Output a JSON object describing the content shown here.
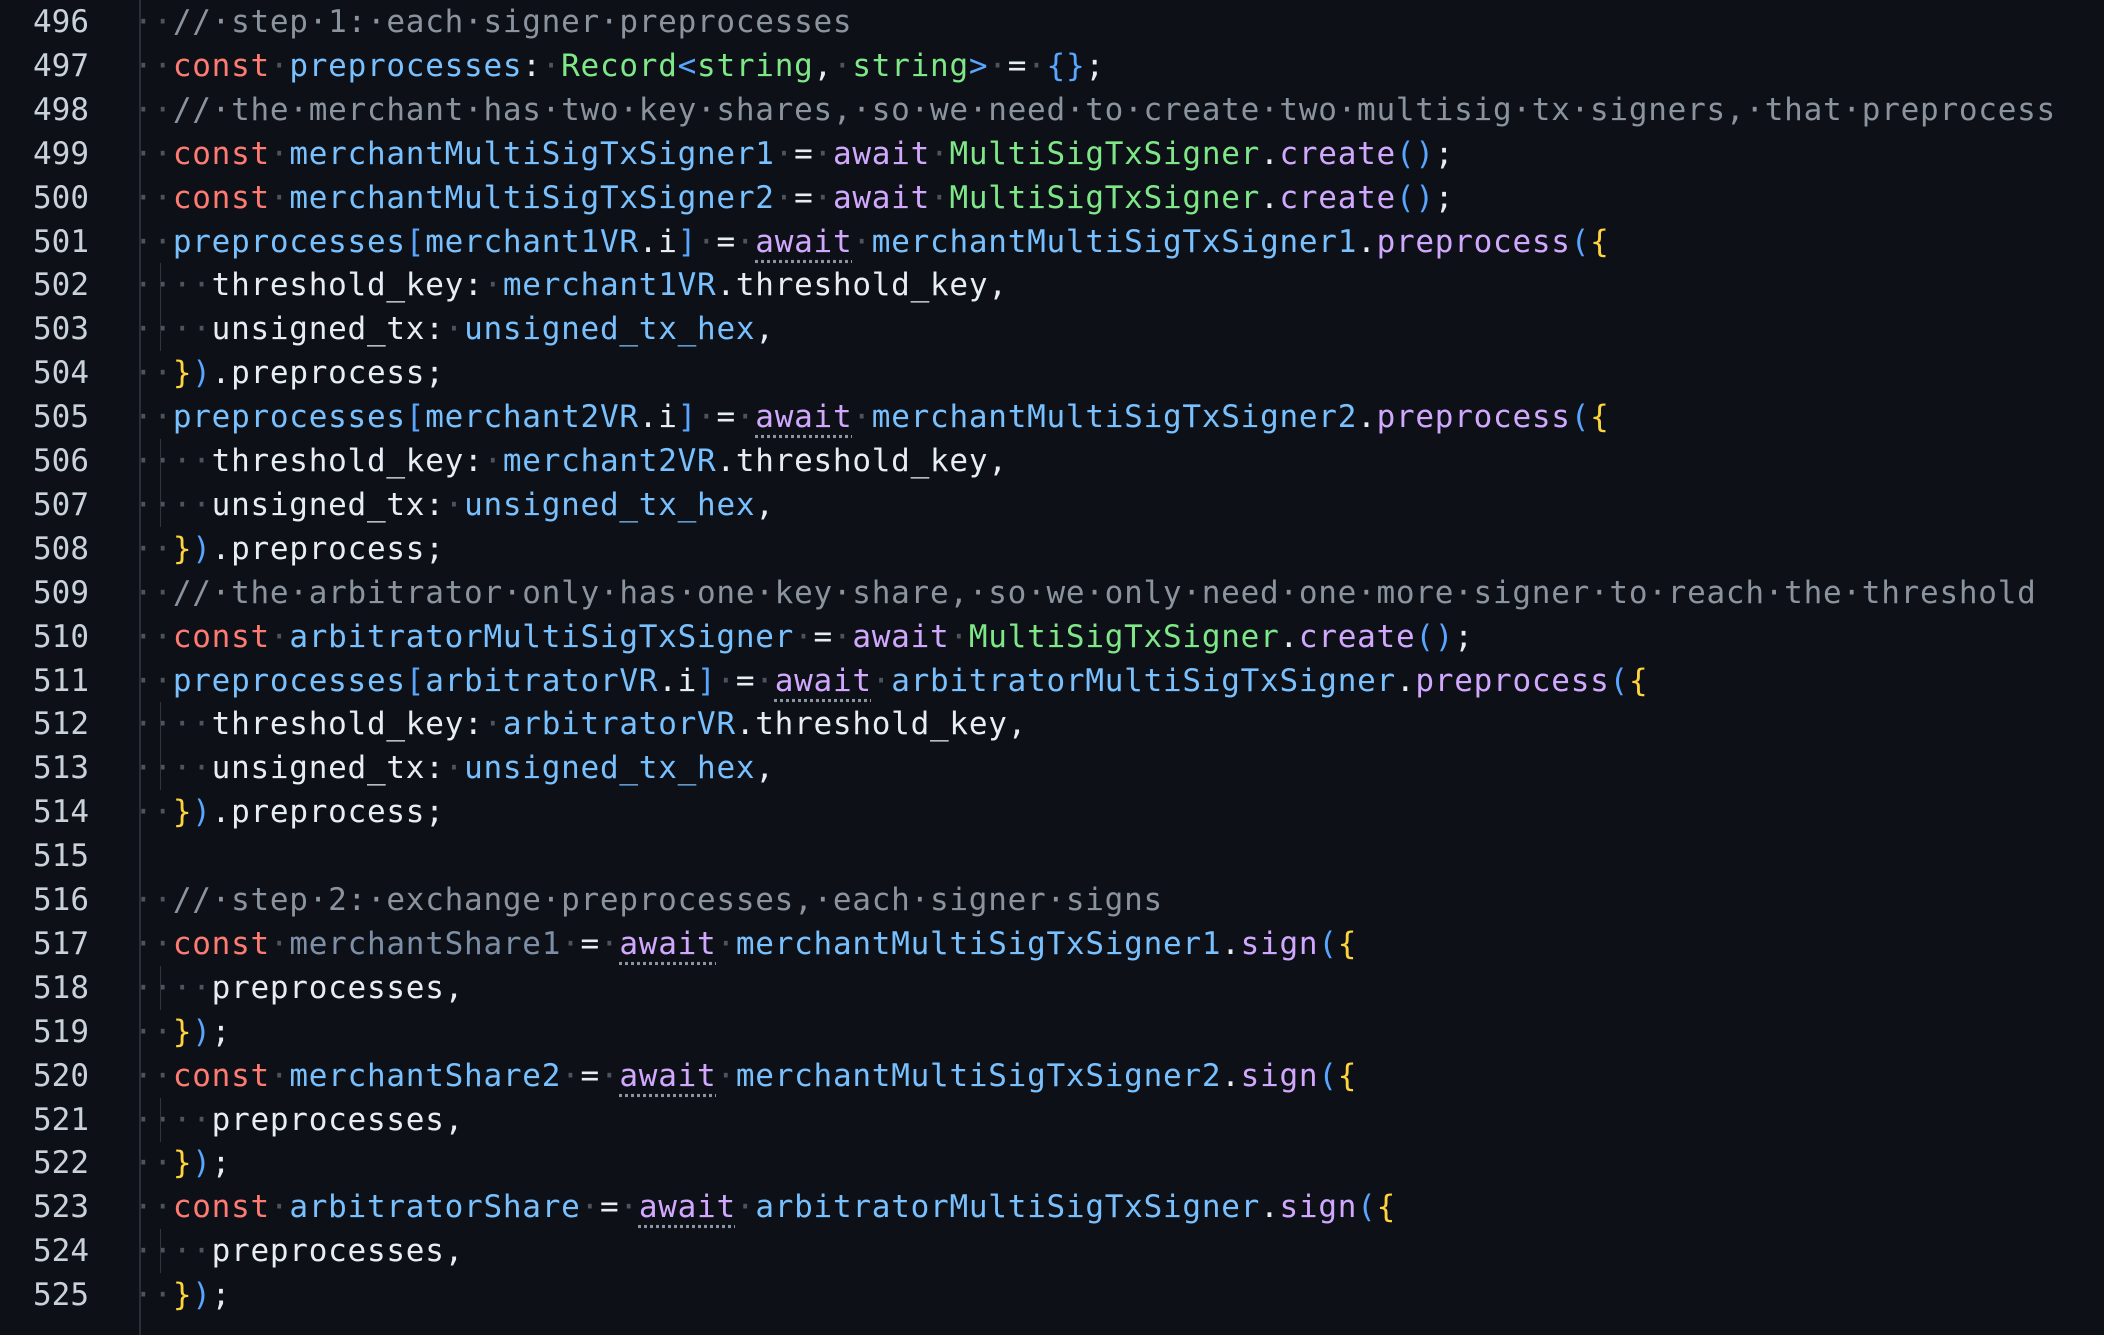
{
  "editor": {
    "colors": {
      "background": "#0d1117",
      "line_number": "#c9d1d9",
      "whitespace_dot": "#4d545d",
      "comment": "#8b949e",
      "keyword": "#ff7b72",
      "await": "#d2a8ff",
      "variable": "#79c0ff",
      "type": "#7ee787",
      "function": "#d2a8ff",
      "brace": "#ffd33d",
      "paren": "#58a6ff"
    },
    "lines": [
      {
        "n": "496",
        "indent": 1,
        "tokens": [
          [
            "comment",
            "//·step·1:·each·signer·preprocesses"
          ]
        ]
      },
      {
        "n": "497",
        "indent": 1,
        "tokens": [
          [
            "keyword",
            "const"
          ],
          [
            "ws",
            "·"
          ],
          [
            "var",
            "preprocesses"
          ],
          [
            "text",
            ":"
          ],
          [
            "ws",
            "·"
          ],
          [
            "type",
            "Record"
          ],
          [
            "paren",
            "<"
          ],
          [
            "type",
            "string"
          ],
          [
            "text",
            ","
          ],
          [
            "ws",
            "·"
          ],
          [
            "type",
            "string"
          ],
          [
            "paren",
            ">"
          ],
          [
            "ws",
            "·"
          ],
          [
            "text",
            "="
          ],
          [
            "ws",
            "·"
          ],
          [
            "paren",
            "{}"
          ],
          [
            "text",
            ";"
          ]
        ]
      },
      {
        "n": "498",
        "indent": 1,
        "tokens": [
          [
            "comment",
            "//·the·merchant·has·two·key·shares,·so·we·need·to·create·two·multisig·tx·signers,·that·preprocess"
          ]
        ]
      },
      {
        "n": "499",
        "indent": 1,
        "tokens": [
          [
            "keyword",
            "const"
          ],
          [
            "ws",
            "·"
          ],
          [
            "var",
            "merchantMultiSigTxSigner1"
          ],
          [
            "ws",
            "·"
          ],
          [
            "text",
            "="
          ],
          [
            "ws",
            "·"
          ],
          [
            "await",
            "await"
          ],
          [
            "ws",
            "·"
          ],
          [
            "type",
            "MultiSigTxSigner"
          ],
          [
            "text",
            "."
          ],
          [
            "func",
            "create"
          ],
          [
            "paren",
            "()"
          ],
          [
            "text",
            ";"
          ]
        ]
      },
      {
        "n": "500",
        "indent": 1,
        "tokens": [
          [
            "keyword",
            "const"
          ],
          [
            "ws",
            "·"
          ],
          [
            "var",
            "merchantMultiSigTxSigner2"
          ],
          [
            "ws",
            "·"
          ],
          [
            "text",
            "="
          ],
          [
            "ws",
            "·"
          ],
          [
            "await",
            "await"
          ],
          [
            "ws",
            "·"
          ],
          [
            "type",
            "MultiSigTxSigner"
          ],
          [
            "text",
            "."
          ],
          [
            "func",
            "create"
          ],
          [
            "paren",
            "()"
          ],
          [
            "text",
            ";"
          ]
        ]
      },
      {
        "n": "501",
        "indent": 1,
        "tokens": [
          [
            "var",
            "preprocesses"
          ],
          [
            "bracket",
            "["
          ],
          [
            "var",
            "merchant1VR"
          ],
          [
            "text",
            ".i"
          ],
          [
            "bracket",
            "]"
          ],
          [
            "ws",
            "·"
          ],
          [
            "text",
            "="
          ],
          [
            "ws",
            "·"
          ],
          [
            "awaitdot",
            "await"
          ],
          [
            "ws",
            "·"
          ],
          [
            "var",
            "merchantMultiSigTxSigner1"
          ],
          [
            "text",
            "."
          ],
          [
            "func",
            "preprocess"
          ],
          [
            "paren",
            "("
          ],
          [
            "brace",
            "{"
          ]
        ]
      },
      {
        "n": "502",
        "indent": 2,
        "tokens": [
          [
            "prop",
            "threshold_key"
          ],
          [
            "text",
            ":"
          ],
          [
            "ws",
            "·"
          ],
          [
            "var",
            "merchant1VR"
          ],
          [
            "text",
            ".threshold_key,"
          ]
        ]
      },
      {
        "n": "503",
        "indent": 2,
        "tokens": [
          [
            "prop",
            "unsigned_tx"
          ],
          [
            "text",
            ":"
          ],
          [
            "ws",
            "·"
          ],
          [
            "var",
            "unsigned_tx_hex"
          ],
          [
            "text",
            ","
          ]
        ]
      },
      {
        "n": "504",
        "indent": 1,
        "tokens": [
          [
            "brace",
            "}"
          ],
          [
            "paren",
            ")"
          ],
          [
            "text",
            ".preprocess;"
          ]
        ]
      },
      {
        "n": "505",
        "indent": 1,
        "tokens": [
          [
            "var",
            "preprocesses"
          ],
          [
            "bracket",
            "["
          ],
          [
            "var",
            "merchant2VR"
          ],
          [
            "text",
            ".i"
          ],
          [
            "bracket",
            "]"
          ],
          [
            "ws",
            "·"
          ],
          [
            "text",
            "="
          ],
          [
            "ws",
            "·"
          ],
          [
            "awaitdot",
            "await"
          ],
          [
            "ws",
            "·"
          ],
          [
            "var",
            "merchantMultiSigTxSigner2"
          ],
          [
            "text",
            "."
          ],
          [
            "func",
            "preprocess"
          ],
          [
            "paren",
            "("
          ],
          [
            "brace",
            "{"
          ]
        ]
      },
      {
        "n": "506",
        "indent": 2,
        "tokens": [
          [
            "prop",
            "threshold_key"
          ],
          [
            "text",
            ":"
          ],
          [
            "ws",
            "·"
          ],
          [
            "var",
            "merchant2VR"
          ],
          [
            "text",
            ".threshold_key,"
          ]
        ]
      },
      {
        "n": "507",
        "indent": 2,
        "tokens": [
          [
            "prop",
            "unsigned_tx"
          ],
          [
            "text",
            ":"
          ],
          [
            "ws",
            "·"
          ],
          [
            "var",
            "unsigned_tx_hex"
          ],
          [
            "text",
            ","
          ]
        ]
      },
      {
        "n": "508",
        "indent": 1,
        "tokens": [
          [
            "brace",
            "}"
          ],
          [
            "paren",
            ")"
          ],
          [
            "text",
            ".preprocess;"
          ]
        ]
      },
      {
        "n": "509",
        "indent": 1,
        "tokens": [
          [
            "comment",
            "//·the·arbitrator·only·has·one·key·share,·so·we·only·need·one·more·signer·to·reach·the·threshold"
          ]
        ]
      },
      {
        "n": "510",
        "indent": 1,
        "tokens": [
          [
            "keyword",
            "const"
          ],
          [
            "ws",
            "·"
          ],
          [
            "var",
            "arbitratorMultiSigTxSigner"
          ],
          [
            "ws",
            "·"
          ],
          [
            "text",
            "="
          ],
          [
            "ws",
            "·"
          ],
          [
            "await",
            "await"
          ],
          [
            "ws",
            "·"
          ],
          [
            "type",
            "MultiSigTxSigner"
          ],
          [
            "text",
            "."
          ],
          [
            "func",
            "create"
          ],
          [
            "paren",
            "()"
          ],
          [
            "text",
            ";"
          ]
        ]
      },
      {
        "n": "511",
        "indent": 1,
        "tokens": [
          [
            "var",
            "preprocesses"
          ],
          [
            "bracket",
            "["
          ],
          [
            "var",
            "arbitratorVR"
          ],
          [
            "text",
            ".i"
          ],
          [
            "bracket",
            "]"
          ],
          [
            "ws",
            "·"
          ],
          [
            "text",
            "="
          ],
          [
            "ws",
            "·"
          ],
          [
            "awaitdot",
            "await"
          ],
          [
            "ws",
            "·"
          ],
          [
            "var",
            "arbitratorMultiSigTxSigner"
          ],
          [
            "text",
            "."
          ],
          [
            "func",
            "preprocess"
          ],
          [
            "paren",
            "("
          ],
          [
            "brace",
            "{"
          ]
        ]
      },
      {
        "n": "512",
        "indent": 2,
        "tokens": [
          [
            "prop",
            "threshold_key"
          ],
          [
            "text",
            ":"
          ],
          [
            "ws",
            "·"
          ],
          [
            "var",
            "arbitratorVR"
          ],
          [
            "text",
            ".threshold_key,"
          ]
        ]
      },
      {
        "n": "513",
        "indent": 2,
        "tokens": [
          [
            "prop",
            "unsigned_tx"
          ],
          [
            "text",
            ":"
          ],
          [
            "ws",
            "·"
          ],
          [
            "var",
            "unsigned_tx_hex"
          ],
          [
            "text",
            ","
          ]
        ]
      },
      {
        "n": "514",
        "indent": 1,
        "tokens": [
          [
            "brace",
            "}"
          ],
          [
            "paren",
            ")"
          ],
          [
            "text",
            ".preprocess;"
          ]
        ]
      },
      {
        "n": "515",
        "indent": 0,
        "tokens": []
      },
      {
        "n": "516",
        "indent": 1,
        "tokens": [
          [
            "comment",
            "//·step·2:·exchange·preprocesses,·each·signer·signs"
          ]
        ]
      },
      {
        "n": "517",
        "indent": 1,
        "tokens": [
          [
            "keyword",
            "const"
          ],
          [
            "ws",
            "·"
          ],
          [
            "dimvar",
            "merchantShare1"
          ],
          [
            "ws",
            "·"
          ],
          [
            "text",
            "="
          ],
          [
            "ws",
            "·"
          ],
          [
            "awaitdot",
            "await"
          ],
          [
            "ws",
            "·"
          ],
          [
            "var",
            "merchantMultiSigTxSigner1"
          ],
          [
            "text",
            "."
          ],
          [
            "func",
            "sign"
          ],
          [
            "paren",
            "("
          ],
          [
            "brace",
            "{"
          ]
        ]
      },
      {
        "n": "518",
        "indent": 2,
        "tokens": [
          [
            "prop",
            "preprocesses,"
          ]
        ]
      },
      {
        "n": "519",
        "indent": 1,
        "tokens": [
          [
            "brace",
            "}"
          ],
          [
            "paren",
            ")"
          ],
          [
            "text",
            ";"
          ]
        ]
      },
      {
        "n": "520",
        "indent": 1,
        "tokens": [
          [
            "keyword",
            "const"
          ],
          [
            "ws",
            "·"
          ],
          [
            "var",
            "merchantShare2"
          ],
          [
            "ws",
            "·"
          ],
          [
            "text",
            "="
          ],
          [
            "ws",
            "·"
          ],
          [
            "awaitdot",
            "await"
          ],
          [
            "ws",
            "·"
          ],
          [
            "var",
            "merchantMultiSigTxSigner2"
          ],
          [
            "text",
            "."
          ],
          [
            "func",
            "sign"
          ],
          [
            "paren",
            "("
          ],
          [
            "brace",
            "{"
          ]
        ]
      },
      {
        "n": "521",
        "indent": 2,
        "tokens": [
          [
            "prop",
            "preprocesses,"
          ]
        ]
      },
      {
        "n": "522",
        "indent": 1,
        "tokens": [
          [
            "brace",
            "}"
          ],
          [
            "paren",
            ")"
          ],
          [
            "text",
            ";"
          ]
        ]
      },
      {
        "n": "523",
        "indent": 1,
        "tokens": [
          [
            "keyword",
            "const"
          ],
          [
            "ws",
            "·"
          ],
          [
            "var",
            "arbitratorShare"
          ],
          [
            "ws",
            "·"
          ],
          [
            "text",
            "="
          ],
          [
            "ws",
            "·"
          ],
          [
            "awaitdot",
            "await"
          ],
          [
            "ws",
            "·"
          ],
          [
            "var",
            "arbitratorMultiSigTxSigner"
          ],
          [
            "text",
            "."
          ],
          [
            "func",
            "sign"
          ],
          [
            "paren",
            "("
          ],
          [
            "brace",
            "{"
          ]
        ]
      },
      {
        "n": "524",
        "indent": 2,
        "tokens": [
          [
            "prop",
            "preprocesses,"
          ]
        ]
      },
      {
        "n": "525",
        "indent": 1,
        "tokens": [
          [
            "brace",
            "}"
          ],
          [
            "paren",
            ")"
          ],
          [
            "text",
            ";"
          ]
        ]
      }
    ]
  }
}
